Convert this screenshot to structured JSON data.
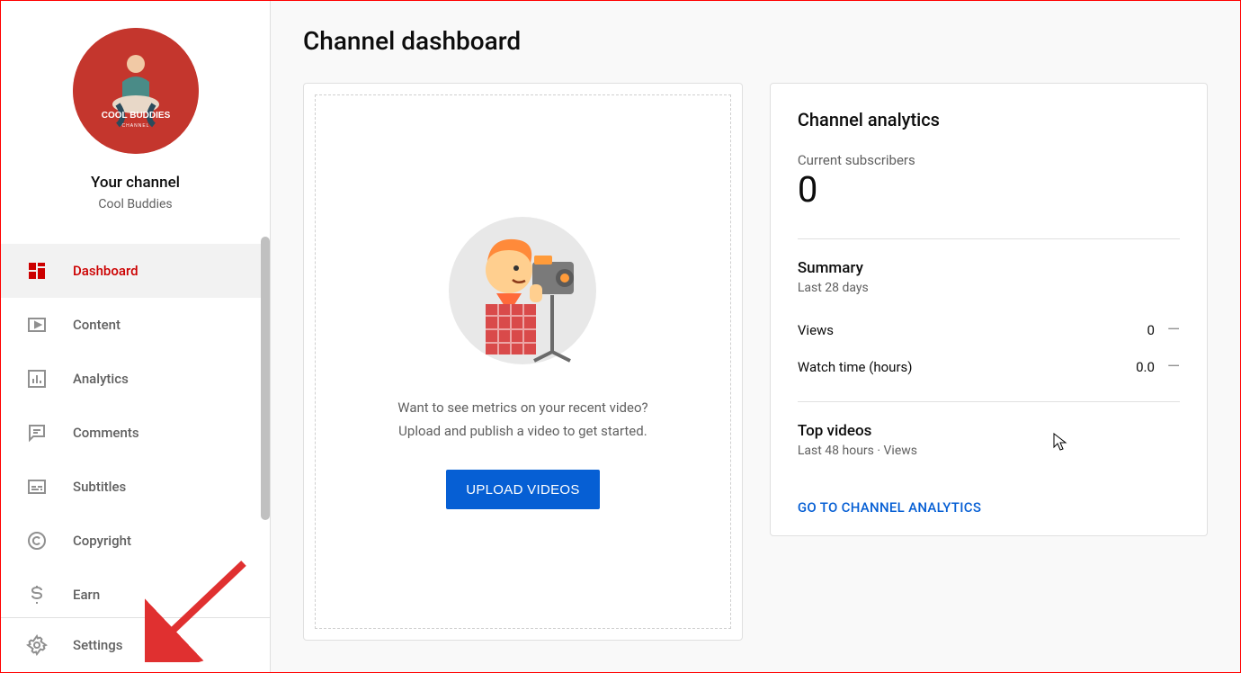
{
  "sidebar": {
    "your_channel_label": "Your channel",
    "channel_name": "Cool Buddies",
    "avatar_text_top": "COOL BUDDIES",
    "avatar_text_bottom": "CHANNEL",
    "items": [
      {
        "label": "Dashboard",
        "active": true
      },
      {
        "label": "Content"
      },
      {
        "label": "Analytics"
      },
      {
        "label": "Comments"
      },
      {
        "label": "Subtitles"
      },
      {
        "label": "Copyright"
      },
      {
        "label": "Earn"
      }
    ],
    "footer": {
      "settings_label": "Settings"
    }
  },
  "page": {
    "title": "Channel dashboard"
  },
  "upload_card": {
    "line1": "Want to see metrics on your recent video?",
    "line2": "Upload and publish a video to get started.",
    "button": "UPLOAD VIDEOS"
  },
  "analytics_card": {
    "title": "Channel analytics",
    "subscribers_label": "Current subscribers",
    "subscribers_count": "0",
    "summary_title": "Summary",
    "summary_sub": "Last 28 days",
    "metrics": [
      {
        "label": "Views",
        "value": "0",
        "delta": "—"
      },
      {
        "label": "Watch time (hours)",
        "value": "0.0",
        "delta": "—"
      }
    ],
    "top_videos_title": "Top videos",
    "top_videos_sub": "Last 48 hours · Views",
    "link": "GO TO CHANNEL ANALYTICS"
  }
}
